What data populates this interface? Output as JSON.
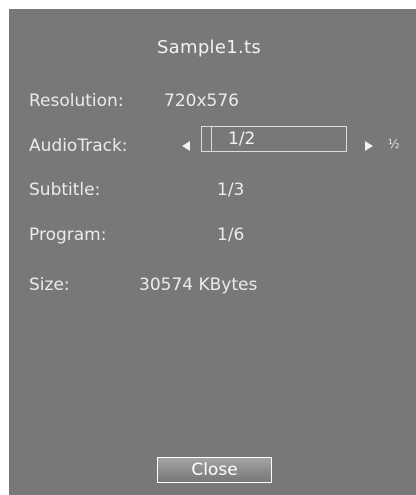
{
  "dialog": {
    "title": "Sample1.ts",
    "resolution": {
      "label": "Resolution:",
      "value": "720x576"
    },
    "audio_track": {
      "label": "AudioTrack:",
      "value": "1/2",
      "side_value": "½"
    },
    "subtitle": {
      "label": "Subtitle:",
      "value": "1/3"
    },
    "program": {
      "label": "Program:",
      "value": "1/6"
    },
    "size": {
      "label": "Size:",
      "value": "30574 KBytes"
    },
    "close_button": {
      "label": "Close"
    }
  },
  "icons": {
    "audio_prev": "left-triangle-icon",
    "audio_next": "right-triangle-icon"
  },
  "colors": {
    "panel_background": "#787878",
    "text": "#ebebeb",
    "button_border": "#ffffff"
  }
}
